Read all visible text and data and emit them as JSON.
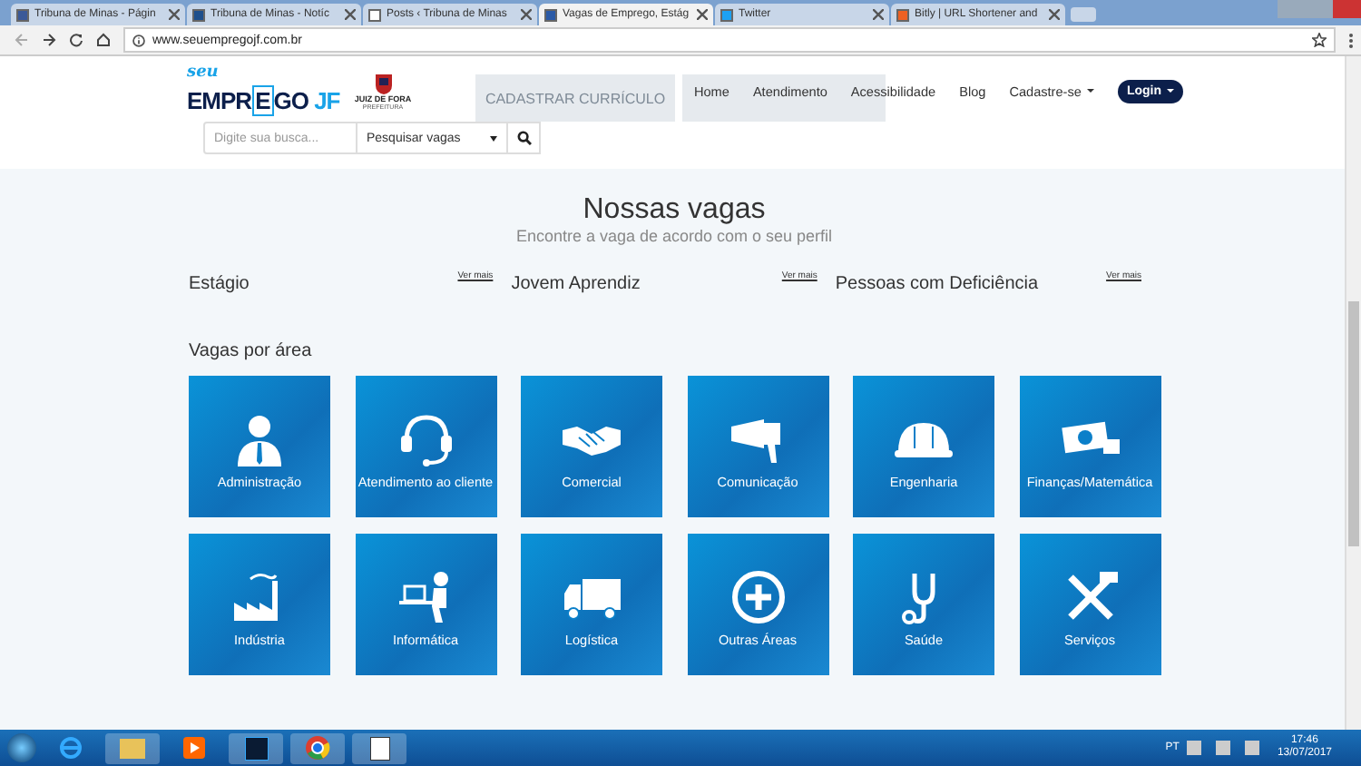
{
  "browser": {
    "tabs": [
      {
        "title": "Tribuna de Minas - Págin",
        "selected": false
      },
      {
        "title": "Tribuna de Minas - Notíc",
        "selected": false
      },
      {
        "title": "Posts ‹ Tribuna de Minas",
        "selected": false
      },
      {
        "title": "Vagas de Emprego, Estág",
        "selected": true
      },
      {
        "title": "Twitter",
        "selected": false
      },
      {
        "title": "Bitly | URL Shortener and",
        "selected": false
      }
    ],
    "address": "www.seuempregojf.com.br"
  },
  "header": {
    "logo": {
      "tagline": "seu",
      "word_start": "EMPR",
      "word_mark": "E",
      "word_end": "GO",
      "suffix": "JF"
    },
    "city_logo": {
      "name": "JUIZ DE FORA",
      "sub": "PREFEITURA"
    },
    "banner_button": "CADASTRAR CURRÍCULO",
    "nav": [
      {
        "label": "Home",
        "dropdown": false
      },
      {
        "label": "Atendimento",
        "dropdown": false
      },
      {
        "label": "Acessibilidade",
        "dropdown": false
      },
      {
        "label": "Blog",
        "dropdown": false
      },
      {
        "label": "Cadastre-se",
        "dropdown": true
      }
    ],
    "login": "Login",
    "search": {
      "placeholder": "Digite sua busca...",
      "select": "Pesquisar vagas"
    }
  },
  "content": {
    "title": "Nossas vagas",
    "subtitle": "Encontre a vaga de acordo com o seu perfil",
    "sections": [
      {
        "title": "Estágio",
        "link": "Ver mais"
      },
      {
        "title": "Jovem Aprendiz",
        "link": "Ver mais"
      },
      {
        "title": "Pessoas com Deficiência",
        "link": "Ver mais"
      }
    ],
    "areas_title": "Vagas por área",
    "areas": [
      {
        "label": "Administração"
      },
      {
        "label": "Atendimento ao cliente"
      },
      {
        "label": "Comercial"
      },
      {
        "label": "Comunicação"
      },
      {
        "label": "Engenharia"
      },
      {
        "label": "Finanças/Matemática"
      },
      {
        "label": "Indústria"
      },
      {
        "label": "Informática"
      },
      {
        "label": "Logística"
      },
      {
        "label": "Outras Áreas"
      },
      {
        "label": "Saúde"
      },
      {
        "label": "Serviços"
      }
    ]
  },
  "taskbar": {
    "language": "PT",
    "time": "17:46",
    "date": "13/07/2017"
  }
}
